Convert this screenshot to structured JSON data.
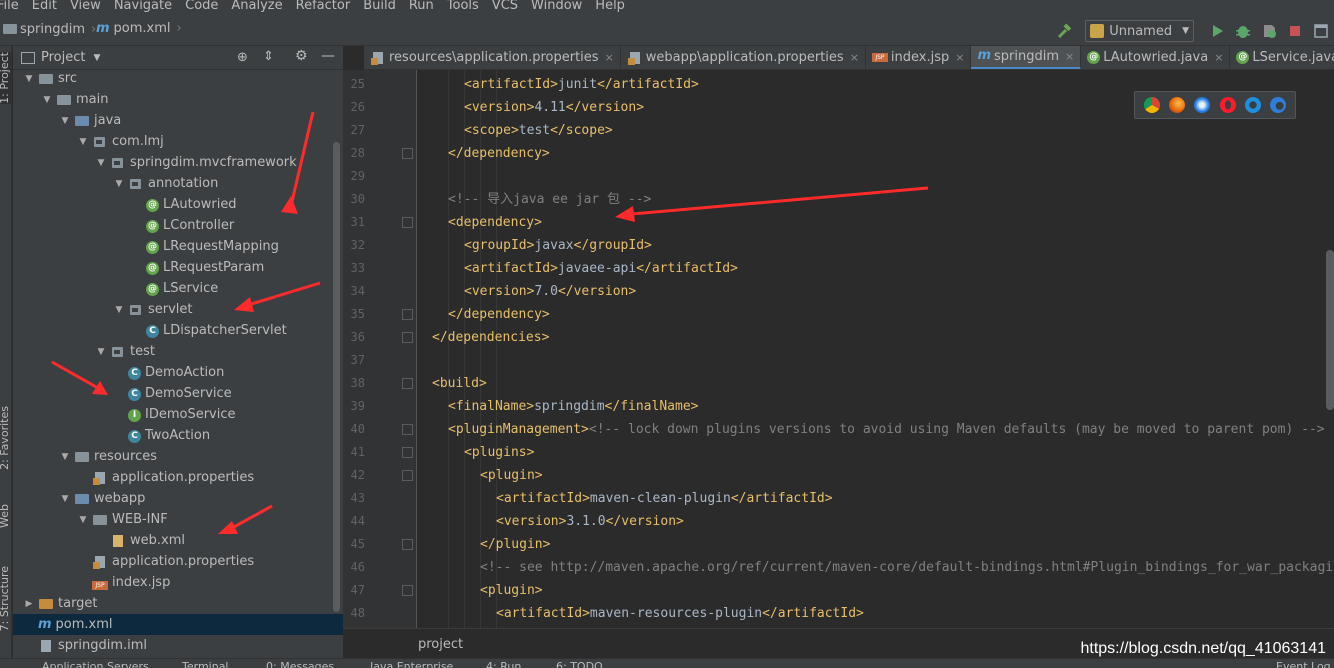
{
  "menu": [
    "File",
    "Edit",
    "View",
    "Navigate",
    "Code",
    "Analyze",
    "Refactor",
    "Build",
    "Run",
    "Tools",
    "VCS",
    "Window",
    "Help"
  ],
  "navbar": {
    "project_crumb": "springdim",
    "file_crumb": "pom.xml",
    "run_config": "Unnamed"
  },
  "left_toolwindows": {
    "project": "1: Project",
    "favorites": "2: Favorites",
    "web": "Web",
    "structure": "7: Structure"
  },
  "project_panel": {
    "title": "Project",
    "tree": [
      {
        "label": "src",
        "depth": 1,
        "icon": "folder",
        "expanded": true
      },
      {
        "label": "main",
        "depth": 2,
        "icon": "folder",
        "expanded": true
      },
      {
        "label": "java",
        "depth": 3,
        "icon": "folder-blue",
        "expanded": true
      },
      {
        "label": "com.lmj",
        "depth": 4,
        "icon": "package",
        "expanded": true
      },
      {
        "label": "springdim.mvcframework",
        "depth": 5,
        "icon": "package",
        "expanded": true
      },
      {
        "label": "annotation",
        "depth": 6,
        "icon": "package",
        "expanded": true
      },
      {
        "label": "LAutowried",
        "depth": 7,
        "icon": "annotation"
      },
      {
        "label": "LController",
        "depth": 7,
        "icon": "annotation"
      },
      {
        "label": "LRequestMapping",
        "depth": 7,
        "icon": "annotation"
      },
      {
        "label": "LRequestParam",
        "depth": 7,
        "icon": "annotation"
      },
      {
        "label": "LService",
        "depth": 7,
        "icon": "annotation"
      },
      {
        "label": "servlet",
        "depth": 6,
        "icon": "package",
        "expanded": true
      },
      {
        "label": "LDispatcherServlet",
        "depth": 7,
        "icon": "class"
      },
      {
        "label": "test",
        "depth": 5,
        "icon": "package",
        "expanded": true
      },
      {
        "label": "DemoAction",
        "depth": 6,
        "icon": "class"
      },
      {
        "label": "DemoService",
        "depth": 6,
        "icon": "class"
      },
      {
        "label": "IDemoService",
        "depth": 6,
        "icon": "interface"
      },
      {
        "label": "TwoAction",
        "depth": 6,
        "icon": "class"
      },
      {
        "label": "resources",
        "depth": 3,
        "icon": "folder",
        "expanded": true
      },
      {
        "label": "application.properties",
        "depth": 4,
        "icon": "properties"
      },
      {
        "label": "webapp",
        "depth": 3,
        "icon": "folder-blue",
        "expanded": true
      },
      {
        "label": "WEB-INF",
        "depth": 4,
        "icon": "folder",
        "expanded": true
      },
      {
        "label": "web.xml",
        "depth": 5,
        "icon": "xml"
      },
      {
        "label": "application.properties",
        "depth": 4,
        "icon": "properties"
      },
      {
        "label": "index.jsp",
        "depth": 4,
        "icon": "jsp"
      },
      {
        "label": "target",
        "depth": 1,
        "icon": "folder-orange",
        "expanded": false
      },
      {
        "label": "pom.xml",
        "depth": 1,
        "icon": "maven",
        "selected": true
      },
      {
        "label": "springdim.iml",
        "depth": 1,
        "icon": "iml"
      }
    ]
  },
  "editor_tabs": [
    {
      "label": "resources\\application.properties",
      "icon": "properties"
    },
    {
      "label": "webapp\\application.properties",
      "icon": "properties"
    },
    {
      "label": "index.jsp",
      "icon": "jsp"
    },
    {
      "label": "springdim",
      "icon": "maven",
      "active": true
    },
    {
      "label": "LAutowried.java",
      "icon": "annotation"
    },
    {
      "label": "LService.java",
      "icon": "annotation"
    }
  ],
  "editor": {
    "lines": [
      {
        "n": "25",
        "indent": 2,
        "parts": [
          [
            "tag",
            "<artifactId>"
          ],
          [
            "txt",
            "junit"
          ],
          [
            "tag",
            "</artifactId>"
          ]
        ]
      },
      {
        "n": "26",
        "indent": 2,
        "parts": [
          [
            "tag",
            "<version>"
          ],
          [
            "txt",
            "4.11"
          ],
          [
            "tag",
            "</version>"
          ]
        ]
      },
      {
        "n": "27",
        "indent": 2,
        "parts": [
          [
            "tag",
            "<scope>"
          ],
          [
            "txt",
            "test"
          ],
          [
            "tag",
            "</scope>"
          ]
        ]
      },
      {
        "n": "28",
        "indent": 1,
        "fold": true,
        "parts": [
          [
            "tag",
            "</dependency>"
          ]
        ]
      },
      {
        "n": "29",
        "indent": 0,
        "parts": []
      },
      {
        "n": "30",
        "indent": 1,
        "parts": [
          [
            "cmt",
            "<!-- 导入java ee jar 包 -->"
          ]
        ]
      },
      {
        "n": "31",
        "indent": 1,
        "fold": true,
        "parts": [
          [
            "tag",
            "<dependency>"
          ]
        ]
      },
      {
        "n": "32",
        "indent": 2,
        "parts": [
          [
            "tag",
            "<groupId>"
          ],
          [
            "txt",
            "javax"
          ],
          [
            "tag",
            "</groupId>"
          ]
        ]
      },
      {
        "n": "33",
        "indent": 2,
        "parts": [
          [
            "tag",
            "<artifactId>"
          ],
          [
            "txt",
            "javaee-api"
          ],
          [
            "tag",
            "</artifactId>"
          ]
        ]
      },
      {
        "n": "34",
        "indent": 2,
        "parts": [
          [
            "tag",
            "<version>"
          ],
          [
            "txt",
            "7.0"
          ],
          [
            "tag",
            "</version>"
          ]
        ]
      },
      {
        "n": "35",
        "indent": 1,
        "fold": true,
        "parts": [
          [
            "tag",
            "</dependency>"
          ]
        ]
      },
      {
        "n": "36",
        "indent": 0,
        "fold": true,
        "parts": [
          [
            "tag",
            "</dependencies>"
          ]
        ]
      },
      {
        "n": "37",
        "indent": 0,
        "parts": []
      },
      {
        "n": "38",
        "indent": 0,
        "fold": true,
        "parts": [
          [
            "tag",
            "<build>"
          ]
        ]
      },
      {
        "n": "39",
        "indent": 1,
        "parts": [
          [
            "tag",
            "<finalName>"
          ],
          [
            "txt",
            "springdim"
          ],
          [
            "tag",
            "</finalName>"
          ]
        ]
      },
      {
        "n": "40",
        "indent": 1,
        "fold": true,
        "parts": [
          [
            "tag",
            "<pluginManagement>"
          ],
          [
            "cmt",
            "<!-- lock down plugins versions to avoid using Maven defaults (may be moved to parent pom) -->"
          ]
        ]
      },
      {
        "n": "41",
        "indent": 2,
        "fold": true,
        "parts": [
          [
            "tag",
            "<plugins>"
          ]
        ]
      },
      {
        "n": "42",
        "indent": 3,
        "fold": true,
        "parts": [
          [
            "tag",
            "<plugin>"
          ]
        ]
      },
      {
        "n": "43",
        "indent": 4,
        "parts": [
          [
            "tag",
            "<artifactId>"
          ],
          [
            "txt",
            "maven-clean-plugin"
          ],
          [
            "tag",
            "</artifactId>"
          ]
        ]
      },
      {
        "n": "44",
        "indent": 4,
        "parts": [
          [
            "tag",
            "<version>"
          ],
          [
            "txt",
            "3.1.0"
          ],
          [
            "tag",
            "</version>"
          ]
        ]
      },
      {
        "n": "45",
        "indent": 3,
        "fold": true,
        "parts": [
          [
            "tag",
            "</plugin>"
          ]
        ]
      },
      {
        "n": "46",
        "indent": 3,
        "parts": [
          [
            "cmt",
            "<!-- see http://maven.apache.org/ref/current/maven-core/default-bindings.html#Plugin_bindings_for_war_packaging -->"
          ]
        ]
      },
      {
        "n": "47",
        "indent": 3,
        "fold": true,
        "parts": [
          [
            "tag",
            "<plugin>"
          ]
        ]
      },
      {
        "n": "48",
        "indent": 4,
        "parts": [
          [
            "tag",
            "<artifactId>"
          ],
          [
            "txt",
            "maven-resources-plugin"
          ],
          [
            "tag",
            "</artifactId>"
          ]
        ]
      }
    ],
    "breadcrumb": "project"
  },
  "watermark": "https://blog.csdn.net/qq_41063141",
  "bottom_tabs": [
    "Application Servers",
    "Terminal",
    "0: Messages",
    "Java Enterprise",
    "4: Run",
    "6: TODO",
    "Event Log"
  ],
  "colors": {
    "tag": "#e8bf6a",
    "text": "#a9b7c6",
    "comment": "#808080",
    "annotation_arrow": "#ff2a2a",
    "selection": "#0d293e"
  }
}
